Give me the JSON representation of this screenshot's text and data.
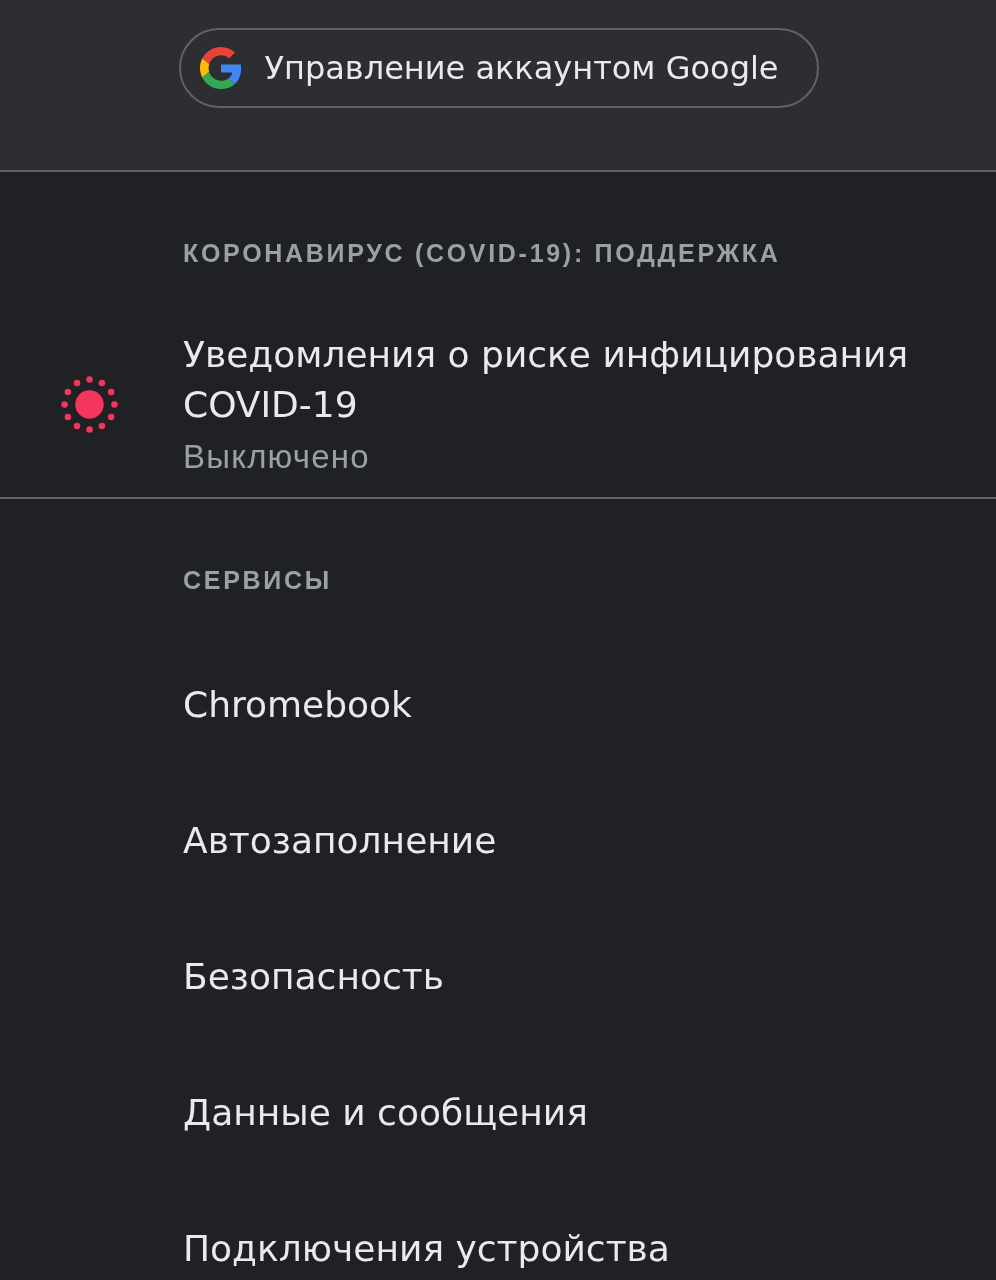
{
  "account_button": {
    "label": "Управление аккаунтом Google"
  },
  "sections": [
    {
      "header": "КОРОНАВИРУС (COVID-19): ПОДДЕРЖКА",
      "items": [
        {
          "kind": "status",
          "title": "Уведомления о риске инфицирования COVID-19",
          "subtitle": "Выключено"
        }
      ]
    },
    {
      "header": "СЕРВИСЫ",
      "items": [
        {
          "kind": "link",
          "title": "Chromebook"
        },
        {
          "kind": "link",
          "title": "Автозаполнение"
        },
        {
          "kind": "link",
          "title": "Безопасность"
        },
        {
          "kind": "link",
          "title": "Данные и сообщения"
        },
        {
          "kind": "link",
          "title": "Подключения устройства"
        }
      ]
    }
  ]
}
